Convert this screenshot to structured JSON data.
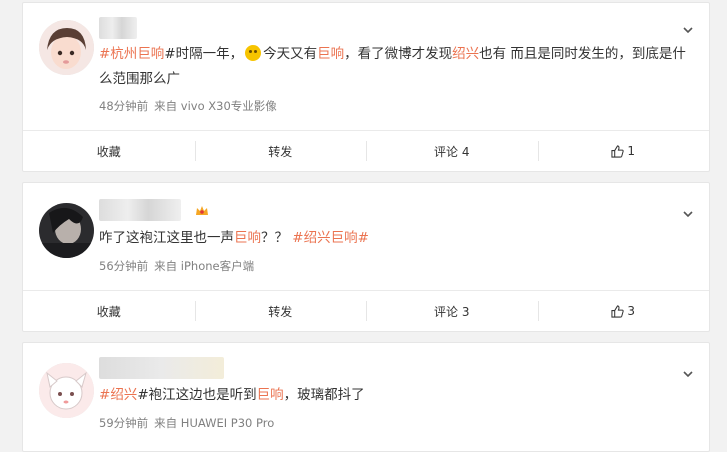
{
  "posts": [
    {
      "text_segments": [
        {
          "text": "#杭州",
          "style": "topic"
        },
        {
          "text": "巨响",
          "style": "hl"
        },
        {
          "text": "#时隔一年，",
          "style": "plain"
        },
        {
          "text": "",
          "style": "emoji"
        },
        {
          "text": "今天又有",
          "style": "plain"
        },
        {
          "text": "巨响",
          "style": "hl"
        },
        {
          "text": "，看了微博才发现",
          "style": "plain"
        },
        {
          "text": "绍兴",
          "style": "hl"
        },
        {
          "text": "也有 而且是同时发生的，到底是什么范围那么广",
          "style": "plain"
        }
      ],
      "time": "48分钟前",
      "source": "来自 vivo X30专业影像",
      "actions": {
        "collect": "收藏",
        "repost": "转发",
        "comment": "评论 4",
        "like": "1"
      }
    },
    {
      "text_segments": [
        {
          "text": "咋了这袍江这里也一声",
          "style": "plain"
        },
        {
          "text": "巨响",
          "style": "hl"
        },
        {
          "text": "？？ ",
          "style": "plain"
        },
        {
          "text": "#",
          "style": "topic"
        },
        {
          "text": "绍兴",
          "style": "hl"
        },
        {
          "text": "巨响",
          "style": "hl"
        },
        {
          "text": "#",
          "style": "topic"
        }
      ],
      "time": "56分钟前",
      "source": "来自 iPhone客户端",
      "actions": {
        "collect": "收藏",
        "repost": "转发",
        "comment": "评论 3",
        "like": "3"
      }
    },
    {
      "text_segments": [
        {
          "text": "#",
          "style": "topic"
        },
        {
          "text": "绍兴",
          "style": "hl"
        },
        {
          "text": "#袍江这边也是听到",
          "style": "plain"
        },
        {
          "text": "巨响",
          "style": "hl"
        },
        {
          "text": "，玻璃都抖了",
          "style": "plain"
        }
      ],
      "time": "59分钟前",
      "source": "来自 HUAWEI P30 Pro"
    }
  ],
  "icons": {
    "menu": "chevron-down-icon",
    "like": "thumbs-up-icon",
    "badge": "crown-icon"
  },
  "colors": {
    "highlight": "#eb7350",
    "meta": "#808080",
    "background": "#f2f2f2"
  }
}
